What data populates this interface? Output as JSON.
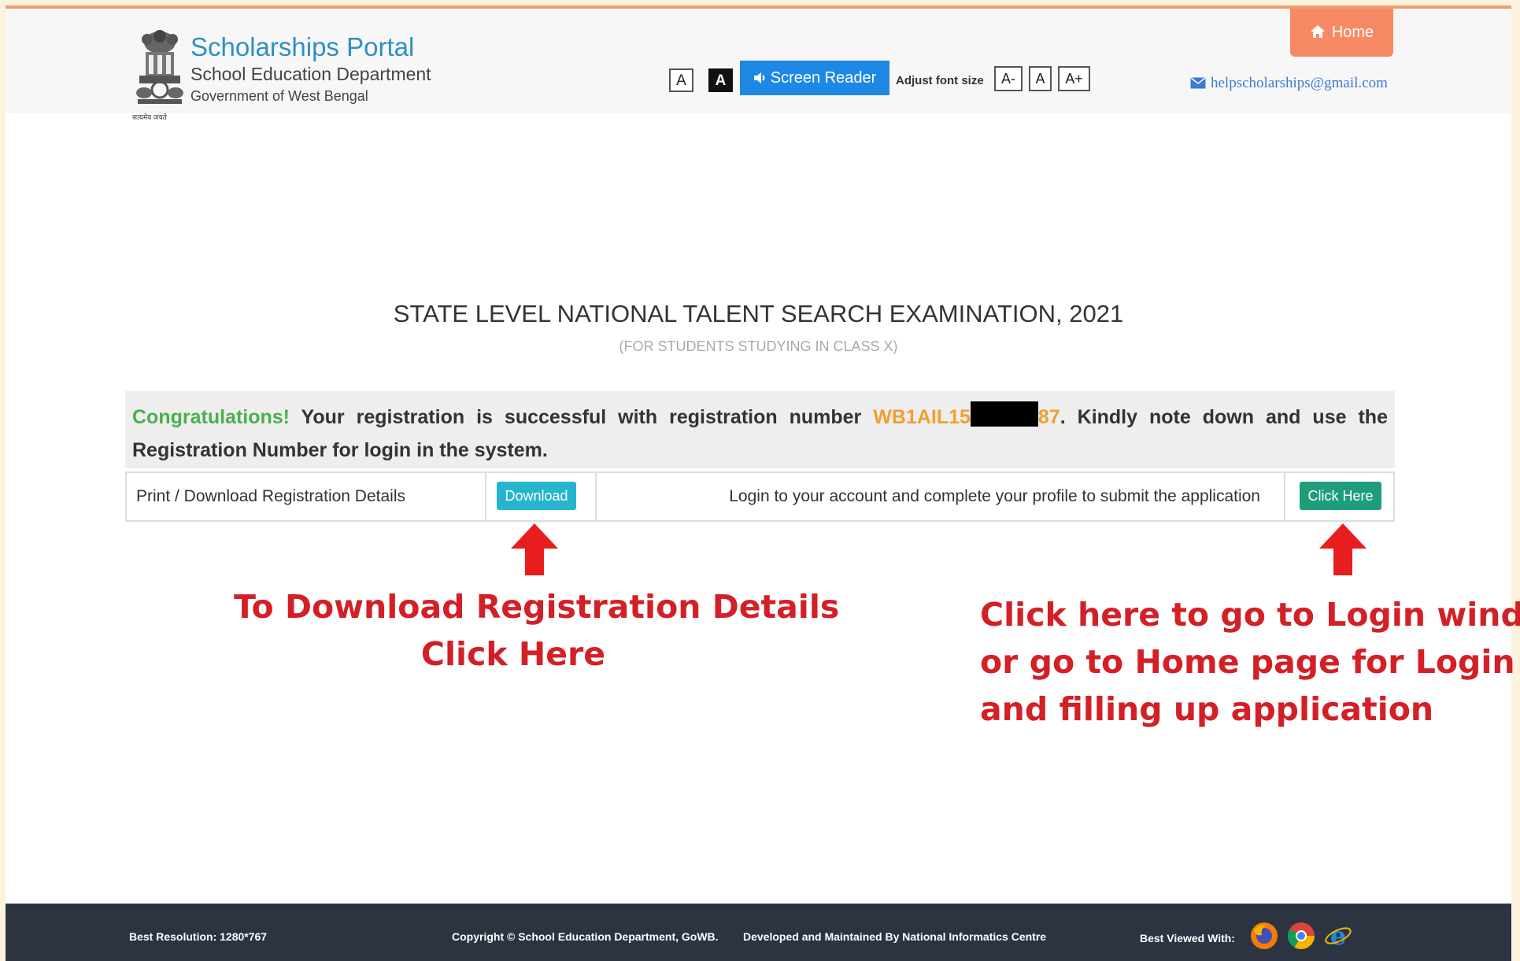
{
  "header": {
    "portal_title": "Scholarships Portal",
    "department": "School Education Department",
    "government": "Government of West Bengal",
    "emblem_caption": "सत्यमेव जयते",
    "contrast_light": "A",
    "contrast_dark": "A",
    "screen_reader": "Screen Reader",
    "adjust_font_label": "Adjust font size",
    "font_decrease": "A-",
    "font_normal": "A",
    "font_increase": "A+",
    "home": "Home",
    "email": "helpscholarships@gmail.com"
  },
  "main": {
    "exam_title": "STATE LEVEL NATIONAL TALENT SEARCH EXAMINATION, 2021",
    "exam_subtitle": "(FOR STUDENTS STUDYING IN CLASS X)",
    "congrats": "Congratulations!",
    "message_pre": " Your registration is successful with registration number ",
    "reg_prefix": "WB1AIL15",
    "reg_suffix": "87",
    "message_post": ". Kindly note down and use the Registration Number for login in the system.",
    "print_label": "Print / Download Registration Details",
    "download_button": "Download",
    "login_text": "Login to your account and complete your profile to submit the application",
    "click_here_button": "Click Here"
  },
  "annotations": {
    "left_line1": "To Download Registration Details",
    "left_line2": "Click Here",
    "right_line1": "Click here to go to Login window",
    "right_line2": "or go to Home page for Login",
    "right_line3": "and filling up application",
    "color": "#d32027"
  },
  "footer": {
    "resolution": "Best Resolution: 1280*767",
    "copyright": "Copyright © School Education Department, GoWB.",
    "developed": "Developed and Maintained By National Informatics Centre",
    "best_viewed": "Best Viewed With:"
  },
  "colors": {
    "accent_blue": "#1e88e5",
    "home_orange": "#f78a64",
    "download_teal": "#26b5cd",
    "click_green": "#1e9d7c",
    "congrats_green": "#4caf50",
    "regno_orange": "#f0a030",
    "footer_bg": "#2b3440"
  }
}
